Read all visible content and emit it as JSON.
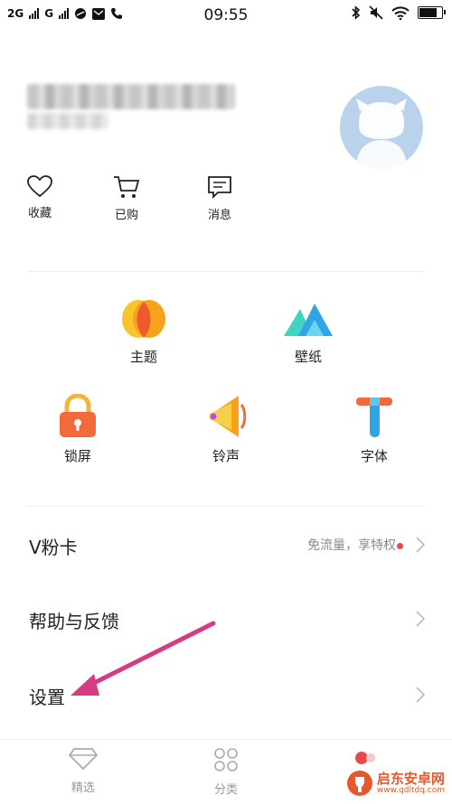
{
  "status_bar": {
    "network1": "2G",
    "network2": "G",
    "time": "09:55",
    "battery_level": 0.85
  },
  "quick_actions": [
    {
      "label": "收藏",
      "icon": "heart-icon"
    },
    {
      "label": "已购",
      "icon": "cart-icon"
    },
    {
      "label": "消息",
      "icon": "message-icon"
    }
  ],
  "tiles": [
    {
      "label": "主题",
      "icon": "theme-icon"
    },
    {
      "label": "壁纸",
      "icon": "wallpaper-icon"
    },
    {
      "label": "锁屏",
      "icon": "lockscreen-icon"
    },
    {
      "label": "铃声",
      "icon": "ringtone-icon"
    },
    {
      "label": "字体",
      "icon": "font-icon"
    }
  ],
  "menu": {
    "vcard": {
      "title": "V粉卡",
      "extra": "免流量，享特权"
    },
    "help": {
      "title": "帮助与反馈"
    },
    "settings": {
      "title": "设置"
    }
  },
  "tabbar": [
    {
      "label": "精选",
      "icon": "diamond-icon"
    },
    {
      "label": "分类",
      "icon": "grid-icon"
    }
  ],
  "watermark": {
    "title": "启东安卓网",
    "url": "www.qdltdq.com"
  },
  "colors": {
    "accent": "#e84a4a",
    "arrow": "#d63c82",
    "text": "#222222",
    "muted": "#8a8a8a"
  }
}
